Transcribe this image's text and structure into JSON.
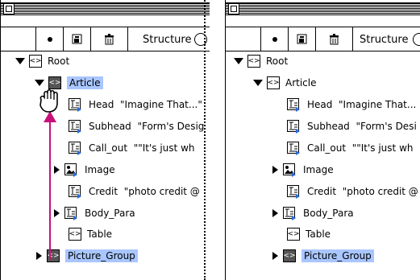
{
  "toolbar": {
    "structure_label": "Structure"
  },
  "left": {
    "rows": [
      {
        "label": "Root"
      },
      {
        "label": "Article"
      },
      {
        "label": "Head",
        "content": "\"Imagine That...\""
      },
      {
        "label": "Subhead",
        "content": "\"Form's Desig"
      },
      {
        "label": "Call_out",
        "content": "\"\"It's just wh"
      },
      {
        "label": "Image"
      },
      {
        "label": "Credit",
        "content": "\"photo credit @"
      },
      {
        "label": "Body_Para"
      },
      {
        "label": "Table"
      },
      {
        "label": "Picture_Group"
      }
    ]
  },
  "right": {
    "rows": [
      {
        "label": "Root"
      },
      {
        "label": "Article"
      },
      {
        "label": "Head",
        "content": "\"Imagine That..."
      },
      {
        "label": "Subhead",
        "content": "\"Form's Desi"
      },
      {
        "label": "Call_out",
        "content": "\"\"It's just wh"
      },
      {
        "label": "Image"
      },
      {
        "label": "Credit",
        "content": "\"photo credit @"
      },
      {
        "label": "Body_Para"
      },
      {
        "label": "Table"
      },
      {
        "label": "Picture_Group"
      }
    ]
  },
  "colors": {
    "highlight": "#a9c6ff",
    "arrow": "#c8107a"
  },
  "icons": {
    "element": "element-icon",
    "text": "text-element-icon",
    "image": "image-element-icon",
    "hand": "grab-hand-icon",
    "bullet": "bullet-icon",
    "new": "new-element-icon",
    "trash": "trash-icon"
  }
}
